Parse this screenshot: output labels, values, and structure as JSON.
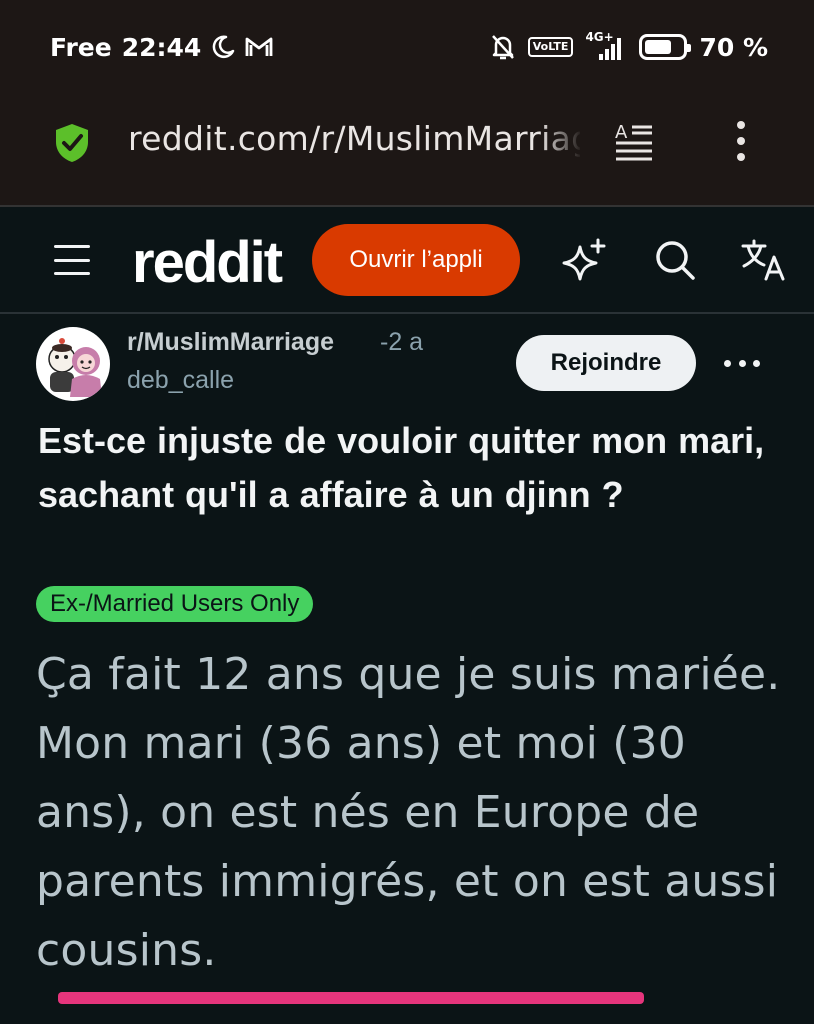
{
  "status_bar": {
    "carrier": "Free",
    "time": "22:44",
    "network": "4G+",
    "volte": "VoLTE",
    "battery": "70 %",
    "battery_level": 0.7
  },
  "browser": {
    "url": "reddit.com/r/MuslimMarriage",
    "secure_color": "#5cbf2a"
  },
  "header": {
    "logo": "reddit",
    "open_app_label": "Ouvrir l’appli",
    "open_app_color": "#d93a00"
  },
  "post": {
    "subreddit": "r/MuslimMarriage",
    "age": "-2 a",
    "author": "deb_calle",
    "join_label": "Rejoindre",
    "title": "Est-ce injuste de vouloir quitter mon mari, sachant qu'il a affaire à un djinn ?",
    "flair": "Ex-/Married Users Only",
    "flair_color": "#46d160",
    "body": "Ça fait 12 ans que je suis mariée. Mon mari (36 ans) et moi (30 ans), on est nés en Europe de parents immigrés, et on est aussi cousins."
  },
  "annotation": {
    "underline_color": "#e6357c"
  },
  "icons": [
    "crescent-moon-icon",
    "gmail-icon",
    "bell-off-icon",
    "signal-icon",
    "battery-icon",
    "shield-check-icon",
    "reader-mode-icon",
    "more-vert-icon",
    "hamburger-icon",
    "sparkle-icon",
    "search-icon",
    "translate-icon",
    "more-horiz-icon"
  ]
}
